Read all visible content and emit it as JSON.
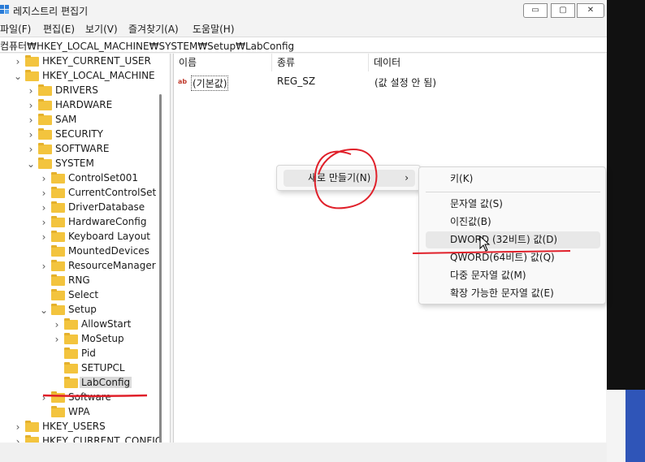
{
  "window": {
    "title": "레지스트리 편집기",
    "controls": {
      "minimize": "▭",
      "maximize": "▢",
      "close": "✕"
    }
  },
  "menu": {
    "items": [
      "파일(F)",
      "편집(E)",
      "보기(V)",
      "즐겨찾기(A)",
      "도움말(H)"
    ]
  },
  "address": {
    "path": "컴퓨터₩HKEY_LOCAL_MACHINE₩SYSTEM₩Setup₩LabConfig"
  },
  "tree": {
    "items": [
      {
        "label": "HKEY_CURRENT_USER",
        "chevron": "›"
      },
      {
        "label": "HKEY_LOCAL_MACHINE",
        "chevron": "⌄"
      },
      {
        "label": "DRIVERS",
        "chevron": "›"
      },
      {
        "label": "HARDWARE",
        "chevron": "›"
      },
      {
        "label": "SAM",
        "chevron": "›"
      },
      {
        "label": "SECURITY",
        "chevron": "›"
      },
      {
        "label": "SOFTWARE",
        "chevron": "›"
      },
      {
        "label": "SYSTEM",
        "chevron": "⌄"
      },
      {
        "label": "ControlSet001",
        "chevron": "›"
      },
      {
        "label": "CurrentControlSet",
        "chevron": "›"
      },
      {
        "label": "DriverDatabase",
        "chevron": "›"
      },
      {
        "label": "HardwareConfig",
        "chevron": "›"
      },
      {
        "label": "Keyboard Layout",
        "chevron": "›"
      },
      {
        "label": "MountedDevices",
        "chevron": ""
      },
      {
        "label": "ResourceManager",
        "chevron": "›"
      },
      {
        "label": "RNG",
        "chevron": ""
      },
      {
        "label": "Select",
        "chevron": ""
      },
      {
        "label": "Setup",
        "chevron": "⌄"
      },
      {
        "label": "AllowStart",
        "chevron": "›"
      },
      {
        "label": "MoSetup",
        "chevron": "›"
      },
      {
        "label": "Pid",
        "chevron": ""
      },
      {
        "label": "SETUPCL",
        "chevron": ""
      },
      {
        "label": "LabConfig",
        "chevron": ""
      },
      {
        "label": "Software",
        "chevron": "›"
      },
      {
        "label": "WPA",
        "chevron": ""
      },
      {
        "label": "HKEY_USERS",
        "chevron": "›"
      },
      {
        "label": "HKEY_CURRENT_CONFIG",
        "chevron": "›"
      }
    ]
  },
  "list": {
    "headers": [
      "이름",
      "종류",
      "데이터"
    ],
    "rows": [
      {
        "icon": "ab",
        "name": "(기본값)",
        "type": "REG_SZ",
        "data": "(값 설정 안 됨)"
      }
    ]
  },
  "context_menu": {
    "item": "새로 만들기(N)",
    "submenu_arrow": "›"
  },
  "submenu": {
    "items": [
      "키(K)",
      "문자열 값(S)",
      "이진값(B)",
      "DWORD (32비트) 값(D)",
      "QWORD(64비트) 값(Q)",
      "다중 문자열 값(M)",
      "확장 가능한 문자열 값(E)"
    ],
    "highlighted": "DWORD (32비트) 값(D)"
  },
  "colors": {
    "annotation_red": "#e0202a",
    "folder_yellow": "#f3c43e",
    "taskbar_blue": "#2f55b8"
  }
}
